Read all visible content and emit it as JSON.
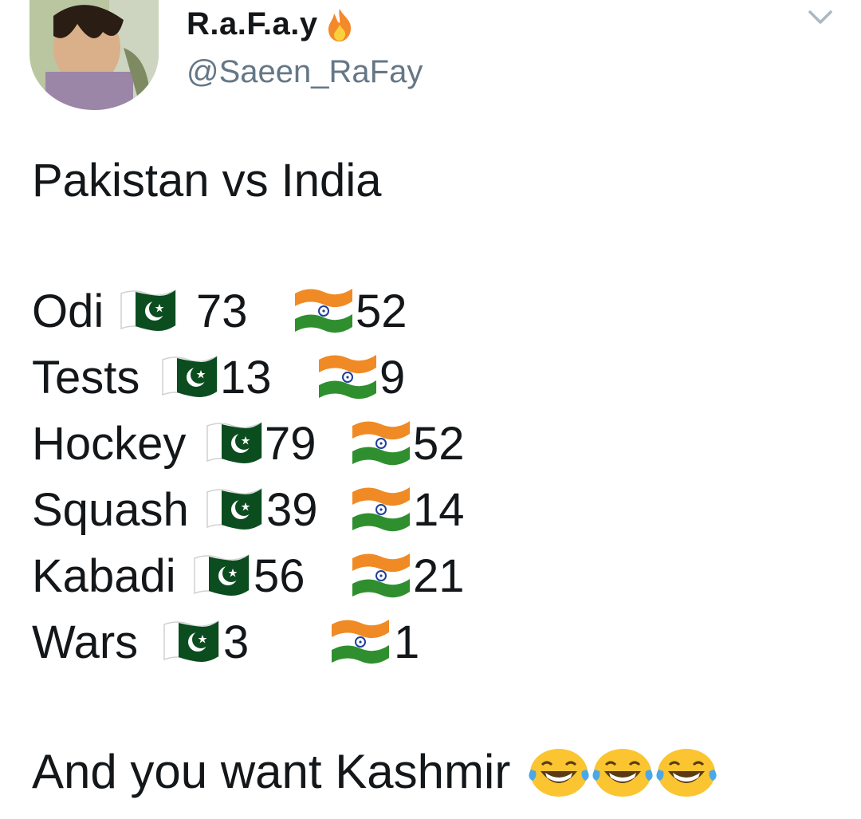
{
  "user": {
    "display_name": "R.a.F.a.y",
    "handle": "@Saeen_RaFay"
  },
  "tweet": {
    "title": "Pakistan vs India",
    "rows": [
      {
        "sport": "Odi",
        "pakistan": "73",
        "india": "52"
      },
      {
        "sport": "Tests",
        "pakistan": "13",
        "india": "9"
      },
      {
        "sport": "Hockey",
        "pakistan": "79",
        "india": "52"
      },
      {
        "sport": "Squash",
        "pakistan": "39",
        "india": "14"
      },
      {
        "sport": "Kabadi",
        "pakistan": "56",
        "india": "21"
      },
      {
        "sport": "Wars",
        "pakistan": "3",
        "india": "1"
      }
    ],
    "closing_line": "And you want Kashmir",
    "closing_emoji": [
      "laughing-tears-icon",
      "laughing-tears-icon",
      "laughing-tears-icon"
    ]
  },
  "icons": {
    "name_badge": "fire-icon",
    "menu": "chevron-down-icon",
    "pakistan_flag": "pakistan-flag-icon",
    "india_flag": "india-flag-icon"
  },
  "colors": {
    "text": "#14171a",
    "muted": "#657786",
    "pakistan_green": "#0b4d1f",
    "india_saffron": "#f08a24",
    "india_green": "#2f8f2f"
  }
}
